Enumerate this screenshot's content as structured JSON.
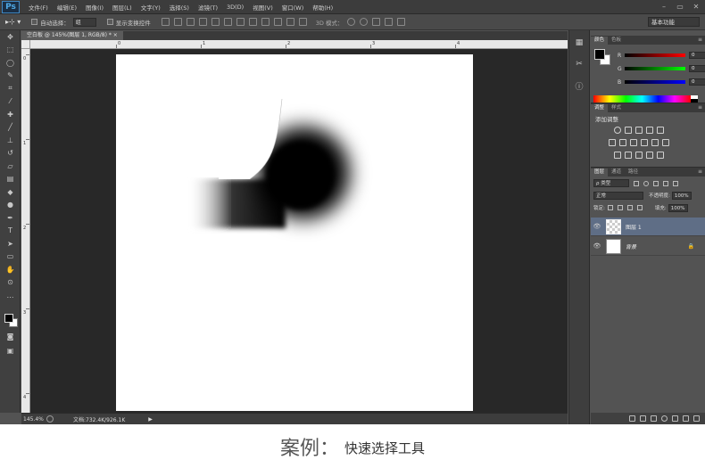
{
  "menubar": {
    "logo": "Ps",
    "items": [
      "文件(F)",
      "编辑(E)",
      "图像(I)",
      "图层(L)",
      "文字(Y)",
      "选择(S)",
      "滤镜(T)",
      "3D(D)",
      "视图(V)",
      "窗口(W)",
      "帮助(H)"
    ]
  },
  "options": {
    "auto_select_label": "自动选择：",
    "auto_select_value": "组",
    "show_transform_label": "显示变换控件",
    "mode_3d_label": "3D 模式：",
    "workspace": "基本功能"
  },
  "document": {
    "tab_title": "空白板 @ 145%(图层 1, RGB/8) * ×",
    "ruler_h_labels": [
      "0",
      "1",
      "2",
      "3",
      "4"
    ],
    "ruler_v_labels": [
      "0",
      "1",
      "2",
      "3",
      "4"
    ],
    "zoom": "145.4%",
    "doc_info": "文档:732.4K/926.1K"
  },
  "color_panel": {
    "tabs": [
      "颜色",
      "色板"
    ],
    "r_label": "R",
    "r_value": "0",
    "g_label": "G",
    "g_value": "0",
    "b_label": "B",
    "b_value": "0"
  },
  "adjust_panel": {
    "tabs": [
      "调整",
      "样式"
    ],
    "title": "添加调整"
  },
  "layers_panel": {
    "tabs": [
      "图层",
      "通道",
      "路径"
    ],
    "filter_kind": "ρ 类型",
    "blend_mode": "正常",
    "opacity_label": "不透明度:",
    "opacity_value": "100%",
    "lock_label": "锁定:",
    "fill_label": "填充:",
    "fill_value": "100%",
    "layers": [
      {
        "name": "图层 1",
        "selected": true
      },
      {
        "name": "背景",
        "selected": false
      }
    ]
  },
  "caption": {
    "title": "案例：",
    "subtitle": "快速选择工具"
  }
}
